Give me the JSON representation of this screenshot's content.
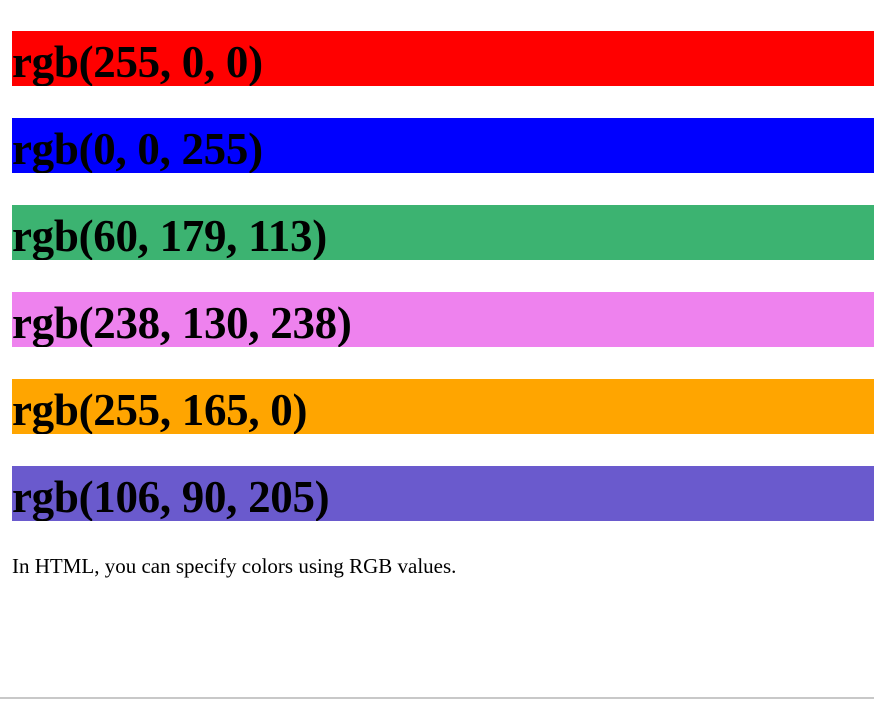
{
  "swatches": [
    {
      "label": "rgb(255, 0, 0)",
      "color": "#ff0000"
    },
    {
      "label": "rgb(0, 0, 255)",
      "color": "#0000ff"
    },
    {
      "label": "rgb(60, 179, 113)",
      "color": "#3cb371"
    },
    {
      "label": "rgb(238, 130, 238)",
      "color": "#ee82ee"
    },
    {
      "label": "rgb(255, 165, 0)",
      "color": "#ffa500"
    },
    {
      "label": "rgb(106, 90, 205)",
      "color": "#6a5acd"
    }
  ],
  "note": "In HTML, you can specify colors using RGB values."
}
